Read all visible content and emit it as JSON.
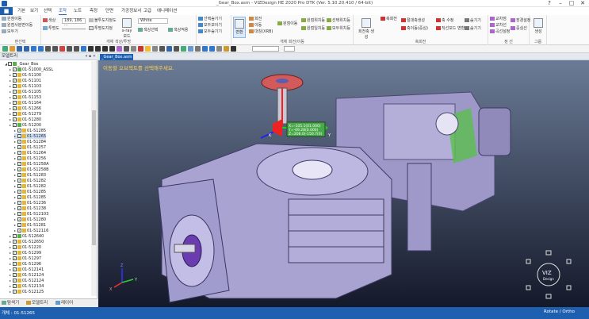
{
  "window": {
    "title": "_Gear_Box.asm - VIZDesign HE 2020 Pro DTK (Ver. 5.10.20.410 / 64-bit)",
    "buttons": [
      "?",
      "–",
      "□",
      "✕"
    ]
  },
  "menu": {
    "file_label": "■",
    "items": [
      "기본",
      "보기",
      "선택",
      "조작",
      "노트",
      "측정",
      "단면",
      "가공정보서",
      "고급",
      "애니메이션"
    ],
    "active_index": 3
  },
  "ribbon": {
    "group1": {
      "title": "편선택",
      "items": [
        "원점이동",
        "원점사분면이동",
        "모두기"
      ]
    },
    "group2": {
      "title": "개체 색상/투명",
      "color_label": "색상",
      "color_value": "189, 186 ...",
      "transparency_label": "투명도",
      "partial_label": "불투도지정도",
      "check_label": "투명도지정",
      "xray_label": "x-ray모드",
      "white_value": "White",
      "btn1": "색상선택",
      "btn2": "색상적용"
    },
    "group3": {
      "items": [
        "선택숨기기",
        "모두보이기",
        "모두숨기기"
      ]
    },
    "group4": {
      "title": "개체 회전/이동",
      "items": [
        "회전",
        "이동",
        "대칭(XRB)",
        "원점이동",
        "원점위치등",
        "원점일치등",
        "선택위치등",
        "모두위치등"
      ],
      "big": "변환"
    },
    "group5": {
      "title": "축회전",
      "items": [
        "회전축 생성",
        "축회전",
        "절대축생성",
        "축이동(중심)",
        "축 수정",
        "직선모드 변환",
        "숨기기",
        "숨기기"
      ]
    },
    "group6": {
      "title": "정 선",
      "items": [
        "교차점",
        "교차선",
        "곡선설정",
        "장경설정",
        "중심선"
      ]
    },
    "group7": {
      "title": "그룹",
      "big": "생성"
    }
  },
  "toolbar2": {
    "zoom_value": ""
  },
  "left_panel": {
    "title": "모델트리",
    "root": "_Gear_Box",
    "rows": [
      {
        "label": "01-51000_ASSL",
        "level": 2,
        "folder": "g"
      },
      {
        "label": "01-51100",
        "level": 2,
        "folder": "y"
      },
      {
        "label": "01-51101",
        "level": 2,
        "folder": "y"
      },
      {
        "label": "01-51103",
        "level": 2,
        "folder": "y"
      },
      {
        "label": "01-51105",
        "level": 2,
        "folder": "y"
      },
      {
        "label": "01-51153",
        "level": 2,
        "folder": "y"
      },
      {
        "label": "01-51164",
        "level": 2,
        "folder": "y"
      },
      {
        "label": "01-51266",
        "level": 2,
        "folder": "y"
      },
      {
        "label": "01-51279",
        "level": 2,
        "folder": "y"
      },
      {
        "label": "01-51280",
        "level": 2,
        "folder": "y"
      },
      {
        "label": "01-51200",
        "level": 2,
        "folder": "g"
      },
      {
        "label": "01-51285",
        "level": 3,
        "folder": "y"
      },
      {
        "label": "01-51265",
        "level": 3,
        "folder": "y",
        "selected": true
      },
      {
        "label": "01-51284",
        "level": 3,
        "folder": "y"
      },
      {
        "label": "01-51257",
        "level": 3,
        "folder": "y"
      },
      {
        "label": "01-51264",
        "level": 3,
        "folder": "y"
      },
      {
        "label": "01-51256",
        "level": 3,
        "folder": "y"
      },
      {
        "label": "01-51258A",
        "level": 3,
        "folder": "y"
      },
      {
        "label": "01-51258B",
        "level": 3,
        "folder": "y"
      },
      {
        "label": "01-51283",
        "level": 3,
        "folder": "y"
      },
      {
        "label": "01-51282",
        "level": 3,
        "folder": "y"
      },
      {
        "label": "01-51282",
        "level": 3,
        "folder": "y"
      },
      {
        "label": "01-51285",
        "level": 3,
        "folder": "y"
      },
      {
        "label": "01-51285",
        "level": 3,
        "folder": "y"
      },
      {
        "label": "01-51236",
        "level": 3,
        "folder": "y"
      },
      {
        "label": "01-51238",
        "level": 3,
        "folder": "y"
      },
      {
        "label": "01-512103",
        "level": 3,
        "folder": "y"
      },
      {
        "label": "01-51280",
        "level": 3,
        "folder": "y"
      },
      {
        "label": "01-51281",
        "level": 3,
        "folder": "y"
      },
      {
        "label": "01-512116",
        "level": 3,
        "folder": "y"
      },
      {
        "label": "01-512640",
        "level": 2,
        "folder": "g"
      },
      {
        "label": "01-512650",
        "level": 2,
        "folder": "y"
      },
      {
        "label": "01-51220",
        "level": 2,
        "folder": "y"
      },
      {
        "label": "01-51299",
        "level": 2,
        "folder": "y"
      },
      {
        "label": "01-51297",
        "level": 2,
        "folder": "y"
      },
      {
        "label": "01-51296",
        "level": 2,
        "folder": "y"
      },
      {
        "label": "01-512141",
        "level": 2,
        "folder": "y"
      },
      {
        "label": "01-512124",
        "level": 2,
        "folder": "y"
      },
      {
        "label": "01-512124",
        "level": 2,
        "folder": "y"
      },
      {
        "label": "01-512134",
        "level": 2,
        "folder": "y"
      },
      {
        "label": "01-512125",
        "level": 2,
        "folder": "y"
      }
    ],
    "tabs": [
      "탐색기",
      "모델트리",
      "레이어"
    ]
  },
  "doc_tab": "_Gear_Box.asm",
  "viewport": {
    "hint": "이동할 오브젝트를 선택해주세요.",
    "coords": [
      "X=-105.1(01.000)",
      "Y=-69.28(0.000)",
      "Z=206.0(-150.7(0)"
    ],
    "axis_labels": {
      "x": "X",
      "y": "Y",
      "z": "Z"
    },
    "gizmo_labels": {
      "k": "K",
      "y": "Y"
    },
    "logo_lines": [
      "VIZ",
      "Design"
    ]
  },
  "status": {
    "left": "개체 : 01-51265",
    "right": "Rotate / Ortho"
  }
}
